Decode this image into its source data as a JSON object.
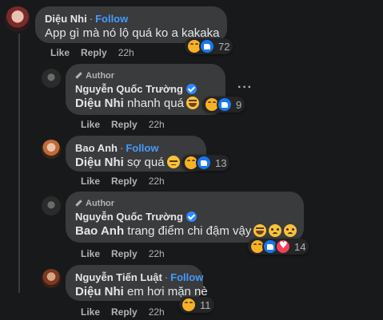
{
  "comments": [
    {
      "name": "Diệu Nhi",
      "follow": "Follow",
      "mention": "",
      "text": "App gì mà nó lộ quá ko a kakaka",
      "reaction_count": "72",
      "actions": {
        "like": "Like",
        "reply": "Reply",
        "time": "22h"
      }
    },
    {
      "author_tag": "Author",
      "name": "Nguyễn Quốc Trường",
      "mention": "Diệu Nhi",
      "text": "nhanh quá",
      "reaction_count": "9",
      "actions": {
        "like": "Like",
        "reply": "Reply",
        "time": "22h"
      },
      "more": "···"
    },
    {
      "name": "Bao Anh",
      "follow": "Follow",
      "mention": "Diệu Nhi",
      "text": "sợ quá",
      "reaction_count": "13",
      "actions": {
        "like": "Like",
        "reply": "Reply",
        "time": "22h"
      }
    },
    {
      "author_tag": "Author",
      "name": "Nguyễn Quốc Trường",
      "mention": "Bao Anh",
      "text": "trang điểm chi đậm vậy",
      "reaction_count": "14",
      "actions": {
        "like": "Like",
        "reply": "Reply",
        "time": "22h"
      }
    },
    {
      "name": "Nguyễn Tiến Luật",
      "follow": "Follow",
      "mention": "Diệu Nhi",
      "text": "em hơi mặn nè",
      "reaction_count": "11",
      "actions": {
        "like": "Like",
        "reply": "Reply",
        "time": "22h"
      }
    }
  ],
  "separator": "·",
  "colors": {
    "background": "#18191a",
    "bubble": "#3a3b3c",
    "follow": "#4599ff",
    "verified": "#2d88ff"
  }
}
